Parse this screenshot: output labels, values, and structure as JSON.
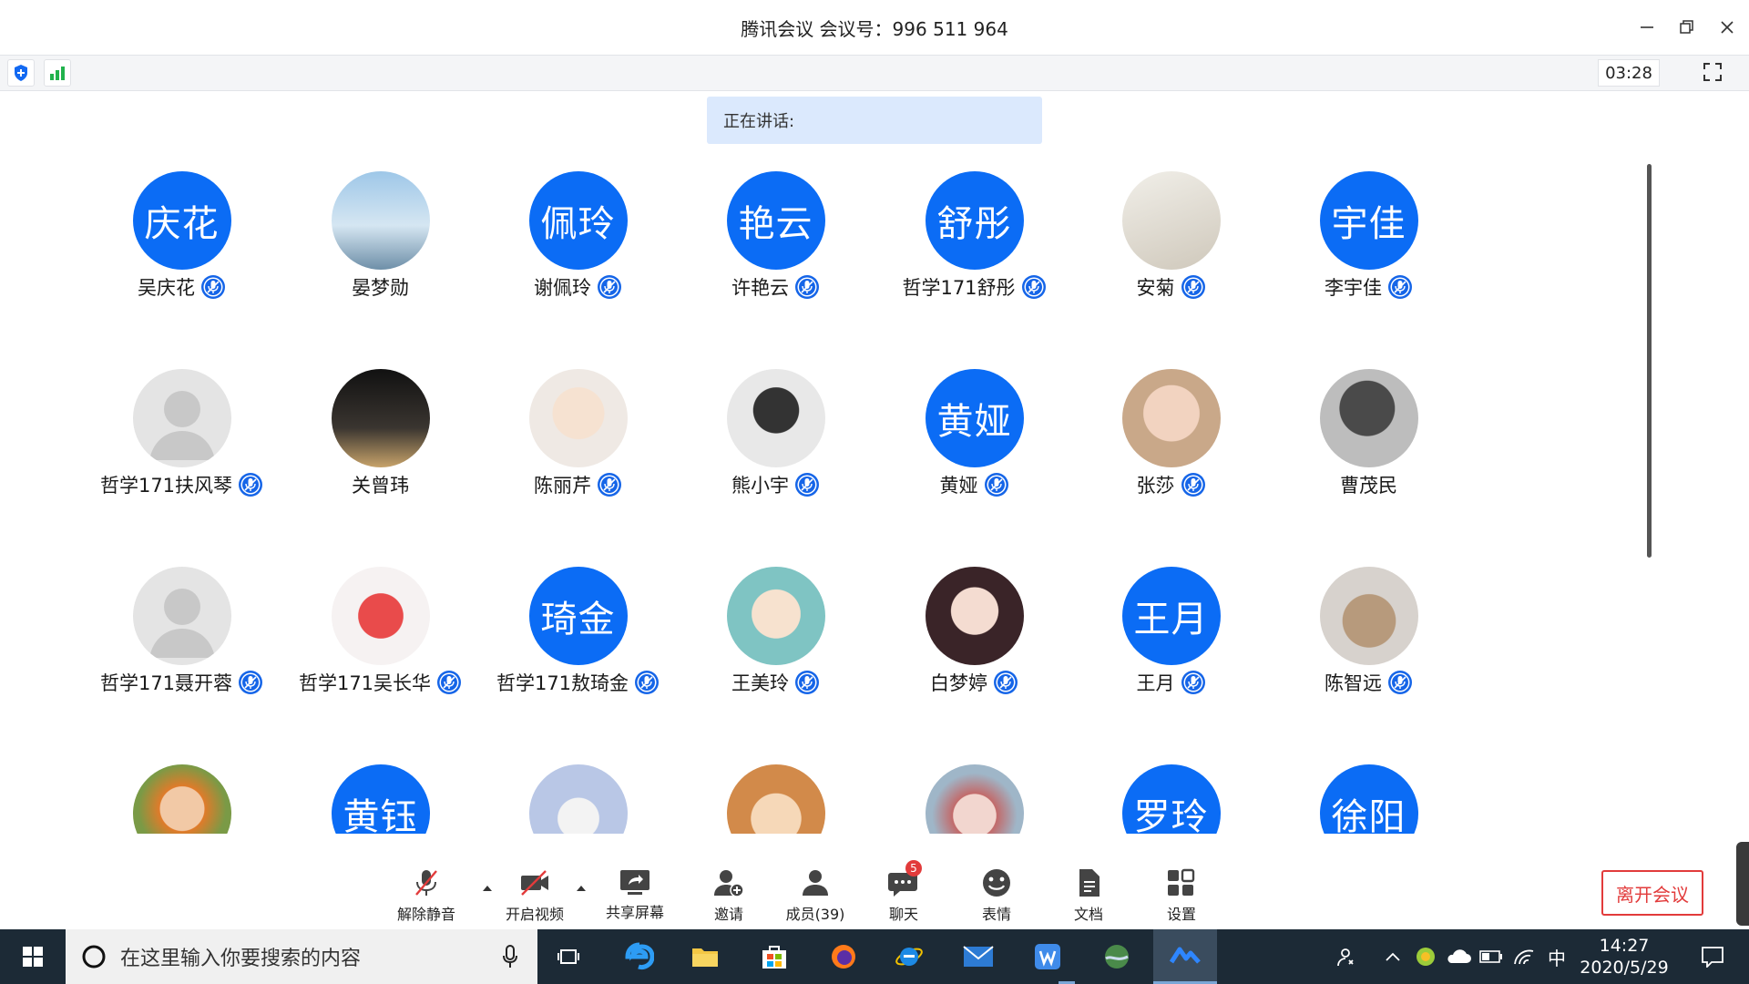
{
  "window": {
    "title": "腾讯会议 会议号：996 511 964"
  },
  "statusbar": {
    "timer": "03:28"
  },
  "speaking": {
    "label": "正在讲话:"
  },
  "participants": [
    {
      "name": "吴庆花",
      "avatar_text": "庆花",
      "avatar_type": "text",
      "mic": true
    },
    {
      "name": "晏梦勋",
      "avatar_text": "",
      "avatar_type": "photo",
      "mic": false
    },
    {
      "name": "谢佩玲",
      "avatar_text": "佩玲",
      "avatar_type": "text",
      "mic": true
    },
    {
      "name": "许艳云",
      "avatar_text": "艳云",
      "avatar_type": "text",
      "mic": true
    },
    {
      "name": "哲学171舒彤",
      "avatar_text": "舒彤",
      "avatar_type": "text",
      "mic": true
    },
    {
      "name": "安菊",
      "avatar_text": "",
      "avatar_type": "photo",
      "mic": true
    },
    {
      "name": "李宇佳",
      "avatar_text": "宇佳",
      "avatar_type": "text",
      "mic": true
    },
    {
      "name": "哲学171扶风琴",
      "avatar_text": "",
      "avatar_type": "default",
      "mic": true
    },
    {
      "name": "关曾玮",
      "avatar_text": "",
      "avatar_type": "photo",
      "mic": false
    },
    {
      "name": "陈丽芹",
      "avatar_text": "",
      "avatar_type": "photo",
      "mic": true
    },
    {
      "name": "熊小宇",
      "avatar_text": "",
      "avatar_type": "photo",
      "mic": true
    },
    {
      "name": "黄娅",
      "avatar_text": "黄娅",
      "avatar_type": "text",
      "mic": true
    },
    {
      "name": "张莎",
      "avatar_text": "",
      "avatar_type": "photo",
      "mic": true
    },
    {
      "name": "曹茂民",
      "avatar_text": "",
      "avatar_type": "photo",
      "mic": false
    },
    {
      "name": "哲学171聂开蓉",
      "avatar_text": "",
      "avatar_type": "default",
      "mic": true
    },
    {
      "name": "哲学171吴长华",
      "avatar_text": "",
      "avatar_type": "photo",
      "mic": true
    },
    {
      "name": "哲学171敖琦金",
      "avatar_text": "琦金",
      "avatar_type": "text",
      "mic": true
    },
    {
      "name": "王美玲",
      "avatar_text": "",
      "avatar_type": "photo",
      "mic": true
    },
    {
      "name": "白梦婷",
      "avatar_text": "",
      "avatar_type": "photo",
      "mic": true
    },
    {
      "name": "王月",
      "avatar_text": "王月",
      "avatar_type": "text",
      "mic": true
    },
    {
      "name": "陈智远",
      "avatar_text": "",
      "avatar_type": "photo",
      "mic": true
    },
    {
      "name": "",
      "avatar_text": "",
      "avatar_type": "photo",
      "mic": false
    },
    {
      "name": "",
      "avatar_text": "黄钰",
      "avatar_type": "text",
      "mic": false
    },
    {
      "name": "",
      "avatar_text": "",
      "avatar_type": "photo",
      "mic": false
    },
    {
      "name": "",
      "avatar_text": "",
      "avatar_type": "photo",
      "mic": false
    },
    {
      "name": "",
      "avatar_text": "",
      "avatar_type": "photo",
      "mic": false
    },
    {
      "name": "",
      "avatar_text": "罗玲",
      "avatar_type": "text",
      "mic": false
    },
    {
      "name": "",
      "avatar_text": "徐阳",
      "avatar_type": "text",
      "mic": false
    }
  ],
  "toolbar": {
    "unmute": "解除静音",
    "video": "开启视频",
    "share": "共享屏幕",
    "invite": "邀请",
    "members": "成员(39)",
    "chat": "聊天",
    "chat_badge": "5",
    "emoji": "表情",
    "docs": "文档",
    "settings": "设置",
    "leave": "离开会议"
  },
  "taskbar": {
    "search_placeholder": "在这里输入你要搜索的内容",
    "time": "14:27",
    "date": "2020/5/29",
    "ime": "中"
  },
  "colors": {
    "accent": "#0b6cf5",
    "leave": "#e23b3b",
    "taskbar": "#1c2a36"
  }
}
